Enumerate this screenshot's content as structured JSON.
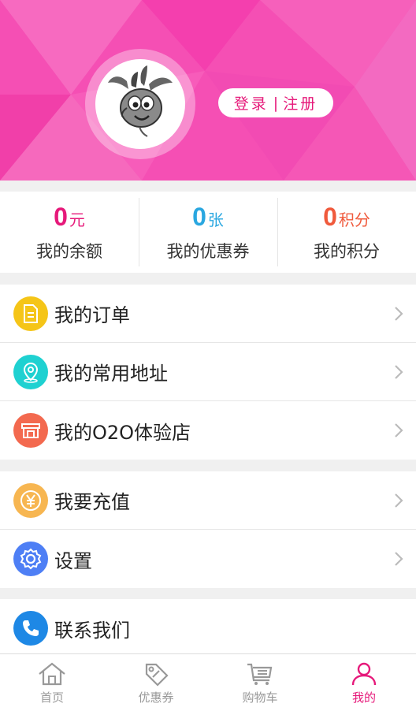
{
  "header": {
    "login_label": "登录",
    "separator": "|",
    "register_label": "注册",
    "bg_color": "#f54fb4"
  },
  "stats": [
    {
      "value": "0",
      "unit": "元",
      "label": "我的余额",
      "color": "#e6197a"
    },
    {
      "value": "0",
      "unit": "张",
      "label": "我的优惠券",
      "color": "#2aa7e0"
    },
    {
      "value": "0",
      "unit": "积分",
      "label": "我的积分",
      "color": "#f05a3c"
    }
  ],
  "menu": {
    "orders": {
      "label": "我的订单",
      "icon": "document-icon",
      "color": "#f5c518"
    },
    "addresses": {
      "label": "我的常用地址",
      "icon": "location-pin-icon",
      "color": "#1fd1d1"
    },
    "store": {
      "label": "我的O2O体验店",
      "icon": "storefront-icon",
      "color": "#f3694f"
    },
    "recharge": {
      "label": "我要充值",
      "icon": "yen-coin-icon",
      "color": "#f7b651"
    },
    "settings": {
      "label": "设置",
      "icon": "gear-icon",
      "color": "#4e7ff5"
    },
    "contact": {
      "label": "联系我们",
      "icon": "phone-icon",
      "color": "#1e88e5"
    }
  },
  "tabbar": [
    {
      "label": "首页",
      "icon": "home-icon"
    },
    {
      "label": "优惠券",
      "icon": "coupon-tag-icon"
    },
    {
      "label": "购物车",
      "icon": "cart-icon"
    },
    {
      "label": "我的",
      "icon": "person-icon",
      "active": true
    }
  ],
  "colors": {
    "accent": "#e6197a",
    "inactive": "#999999"
  }
}
